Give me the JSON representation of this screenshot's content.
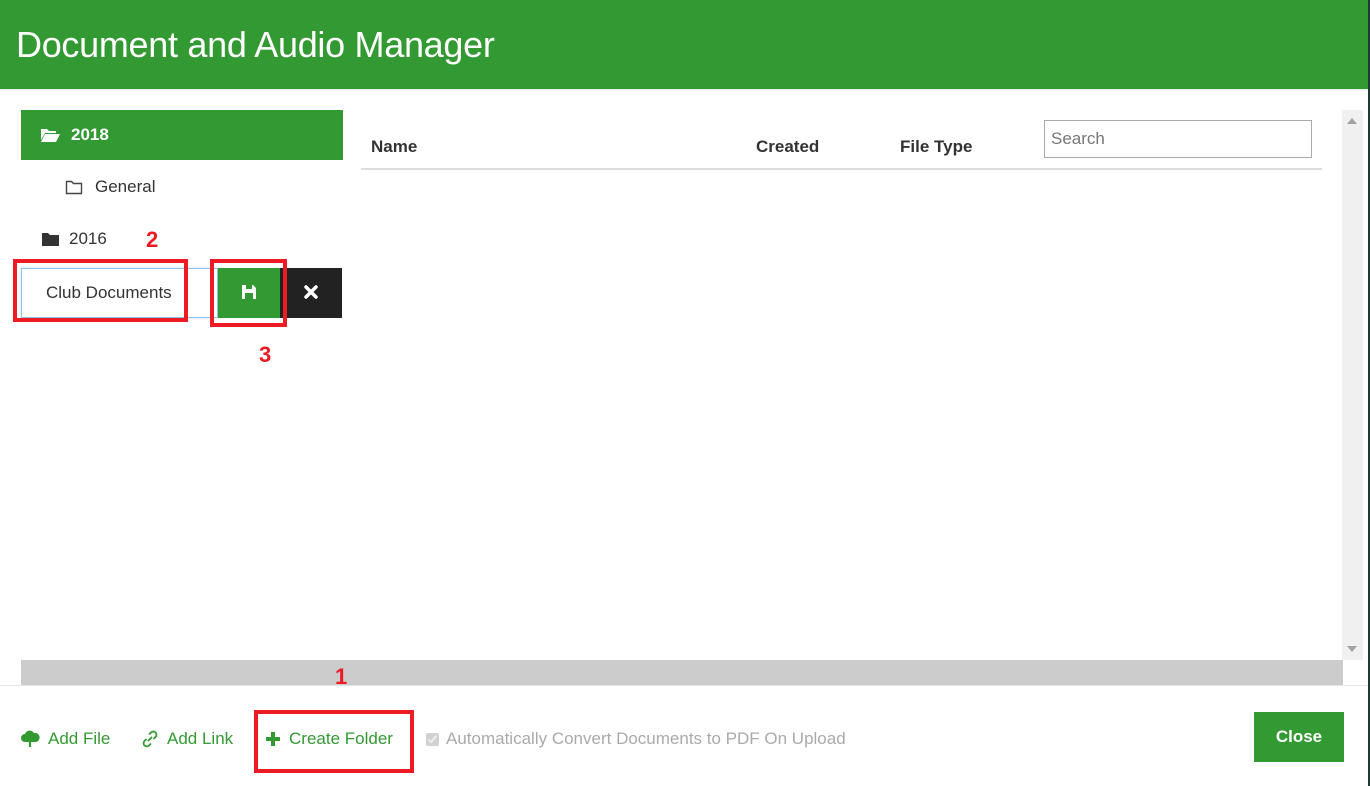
{
  "header": {
    "title": "Document and Audio Manager"
  },
  "tree": {
    "items": [
      {
        "label": "2018",
        "icon": "folder-open-icon",
        "state": "selected"
      },
      {
        "label": "General",
        "icon": "folder-outline-icon",
        "state": "child"
      },
      {
        "label": "2016",
        "icon": "folder-closed-icon",
        "state": "normal"
      }
    ],
    "new_folder": {
      "value": "Club Documents",
      "save_icon": "floppy-disk-icon",
      "cancel_icon": "close-icon"
    }
  },
  "table": {
    "columns": [
      "Name",
      "Created",
      "File Type"
    ],
    "rows": [],
    "search_placeholder": "Search"
  },
  "footer": {
    "add_file": "Add File",
    "add_link": "Add Link",
    "create_folder": "Create Folder",
    "convert_label": "Automatically Convert Documents to PDF On Upload",
    "convert_checked": true,
    "close": "Close"
  },
  "annotations": [
    "1",
    "2",
    "3"
  ],
  "colors": {
    "brand": "#339933",
    "dark": "#222222",
    "annotation": "#ed1c24"
  }
}
